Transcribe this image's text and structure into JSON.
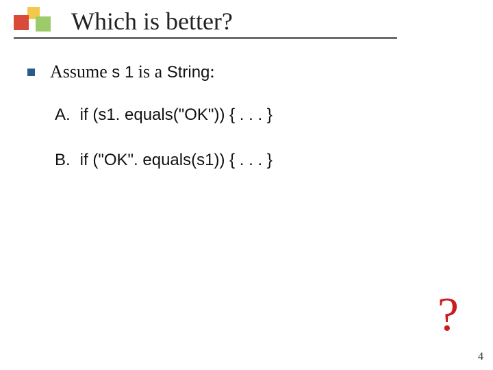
{
  "title": "Which is better?",
  "assume": {
    "prefix": "Assume ",
    "var": "s 1",
    "mid": " is a ",
    "type": "String",
    "suffix": ":"
  },
  "options": [
    {
      "label": "A.",
      "code": "if (s1. equals(\"OK\")) { . . . }"
    },
    {
      "label": "B.",
      "code": "if (\"OK\". equals(s1)) { . . . }"
    }
  ],
  "question_mark": "?",
  "page_number": "4"
}
